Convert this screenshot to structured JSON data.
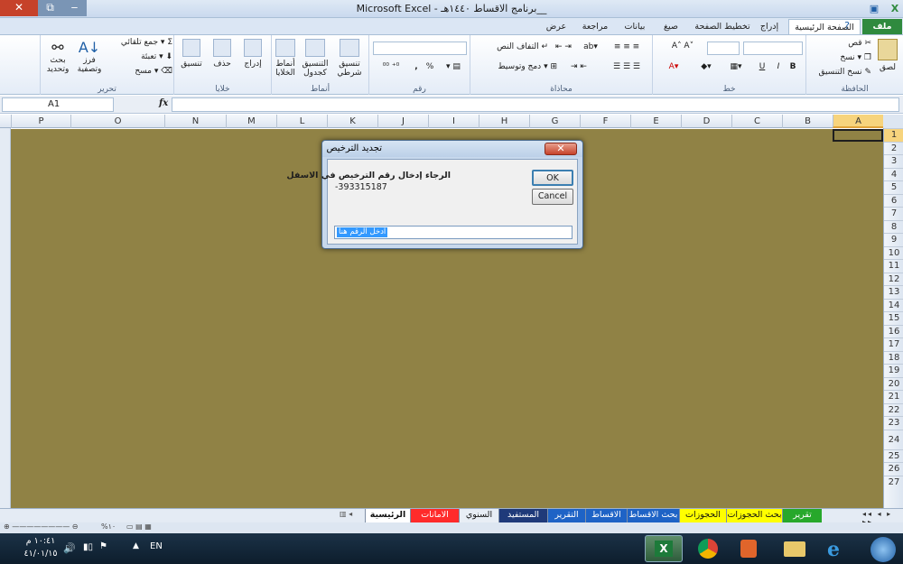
{
  "window": {
    "title": "Microsoft Excel - برنامج الاقساط ١٤٤٠هـ__",
    "controls": {
      "close": "✕",
      "restore": "⧉",
      "minimize": "‒"
    }
  },
  "tabs": [
    {
      "label": "ملف",
      "name": "tab-file"
    },
    {
      "label": "الصفحة الرئيسية",
      "name": "tab-home"
    },
    {
      "label": "إدراج",
      "name": "tab-insert"
    },
    {
      "label": "تخطيط الصفحة",
      "name": "tab-page-layout"
    },
    {
      "label": "صيغ",
      "name": "tab-formulas"
    },
    {
      "label": "بيانات",
      "name": "tab-data"
    },
    {
      "label": "مراجعة",
      "name": "tab-review"
    },
    {
      "label": "عرض",
      "name": "tab-view"
    }
  ],
  "ribbon": {
    "clipboard": {
      "label": "الحافظة",
      "paste": "لصق",
      "cut": "قص",
      "copy": "نسخ",
      "format_painter": "نسخ التنسيق"
    },
    "font": {
      "label": "خط",
      "bold": "B",
      "italic": "I",
      "underline": "U"
    },
    "alignment": {
      "label": "محاذاة",
      "wrap": "التفاف النص",
      "merge": "دمج وتوسيط"
    },
    "number": {
      "label": "رقم",
      "percent": "%",
      "comma": ","
    },
    "styles": {
      "label": "أنماط",
      "conditional": "تنسيق شرطي",
      "as_table": "التنسيق كجدول",
      "cell_styles": "أنماط الخلايا"
    },
    "cells": {
      "label": "خلايا",
      "insert": "إدراج",
      "delete": "حذف",
      "format": "تنسيق"
    },
    "editing": {
      "label": "تحرير",
      "autosum": "جمع تلقائي",
      "fill": "تعبئة",
      "clear": "مسح",
      "sort": "فرز وتصفية",
      "find": "بحث وتحديد"
    }
  },
  "formula_bar": {
    "name_box": "A1",
    "fx": "fx",
    "formula": ""
  },
  "columns": [
    "A",
    "B",
    "C",
    "D",
    "E",
    "F",
    "G",
    "H",
    "I",
    "J",
    "K",
    "L",
    "M",
    "N",
    "O",
    "P"
  ],
  "selected_column": "A",
  "rows": [
    "1",
    "2",
    "3",
    "4",
    "5",
    "6",
    "7",
    "8",
    "9",
    "10",
    "11",
    "12",
    "13",
    "14",
    "15",
    "16",
    "17",
    "18",
    "19",
    "20",
    "21",
    "22",
    "23",
    "24",
    "25",
    "26",
    "27"
  ],
  "selected_row": "1",
  "sheet_tabs": [
    {
      "label": "الرئيسية",
      "color": "#ffffff",
      "active": true
    },
    {
      "label": "الامانات",
      "color": "#ff2b2b"
    },
    {
      "label": "السنوي",
      "color": "#e8eef5"
    },
    {
      "label": "المستفيد",
      "color": "#1f3a7a"
    },
    {
      "label": "التقرير",
      "color": "#1e63c6"
    },
    {
      "label": "الاقساط",
      "color": "#1e63c6"
    },
    {
      "label": "بحث الاقساط",
      "color": "#1e63c6"
    },
    {
      "label": "الحجوزات",
      "color": "#ffff00"
    },
    {
      "label": "بحث الحجوزات",
      "color": "#ffff00"
    },
    {
      "label": "تقرير",
      "color": "#27a82b"
    }
  ],
  "status": {
    "zoom": "%١٠"
  },
  "taskbar": {
    "lang": "EN",
    "time": "١٠:٤١ م",
    "date": "٤١/٠١/١٥"
  },
  "dialog": {
    "title": "تجديد الترخيص",
    "message": "الرجاء إدخال رقم الترخيص في الاسفل",
    "number": "-393315187",
    "ok": "OK",
    "cancel": "Cancel",
    "input_value": "ادخل الرقم هنا"
  },
  "colors": {
    "grid_bg": "#908245",
    "file_tab": "#2f8a3e",
    "selection": "#f7d47d"
  }
}
